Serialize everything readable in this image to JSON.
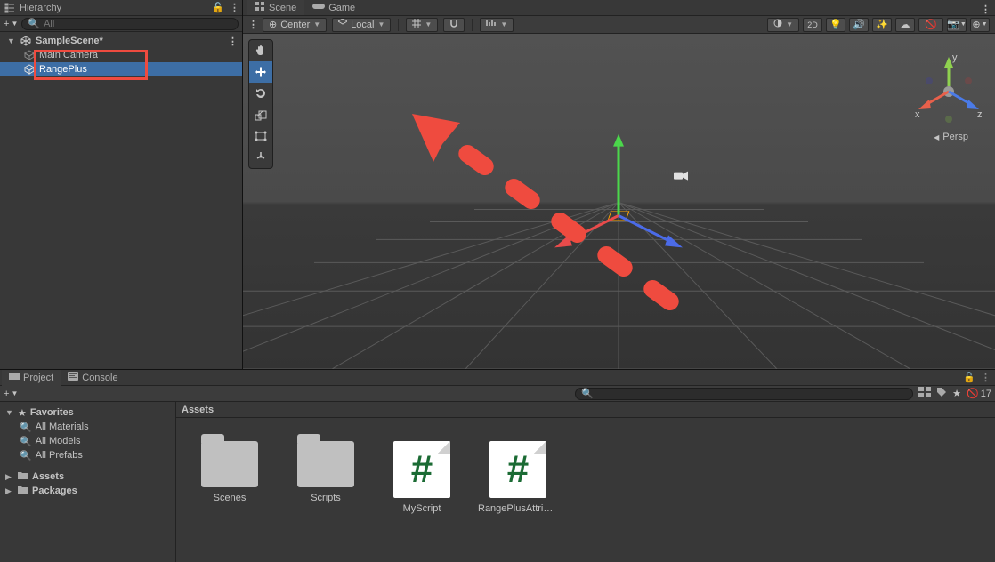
{
  "hierarchy": {
    "title": "Hierarchy",
    "search_placeholder": "All",
    "scene_name": "SampleScene*",
    "items": [
      {
        "name": "Main Camera",
        "selected": false
      },
      {
        "name": "RangePlus",
        "selected": true
      }
    ]
  },
  "scene": {
    "tabs": [
      {
        "label": "Scene",
        "icon": "scene",
        "active": true
      },
      {
        "label": "Game",
        "icon": "game",
        "active": false
      }
    ],
    "toolbar": {
      "pivot": "Center",
      "space": "Local",
      "twoD": "2D"
    },
    "axes": {
      "x": "x",
      "y": "y",
      "z": "z"
    },
    "persp_label": "Persp"
  },
  "project": {
    "tabs": [
      {
        "label": "Project",
        "icon": "folder",
        "active": true
      },
      {
        "label": "Console",
        "icon": "console",
        "active": false
      }
    ],
    "hidden_count": "17",
    "breadcrumb": "Assets",
    "favorites_label": "Favorites",
    "favorites": [
      "All Materials",
      "All Models",
      "All Prefabs"
    ],
    "roots": [
      {
        "label": "Assets",
        "expandable": true
      },
      {
        "label": "Packages",
        "expandable": true
      }
    ],
    "assets": [
      {
        "label": "Scenes",
        "type": "folder"
      },
      {
        "label": "Scripts",
        "type": "folder"
      },
      {
        "label": "MyScript",
        "type": "script"
      },
      {
        "label": "RangePlusAttribu...",
        "type": "script"
      }
    ]
  },
  "annotation": {
    "color": "#ef4b3f"
  }
}
